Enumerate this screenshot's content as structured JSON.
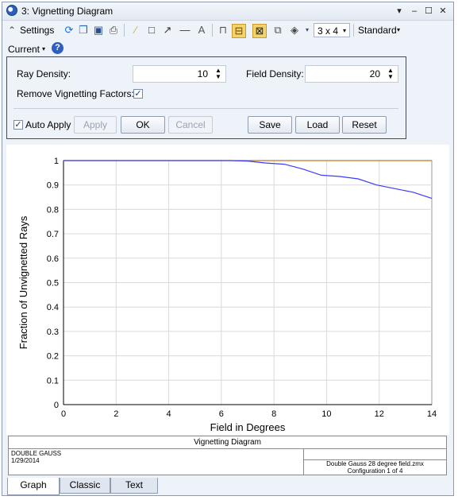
{
  "window": {
    "title": "3: Vignetting Diagram"
  },
  "toolbar": {
    "settings_label": "Settings",
    "grid_layout": "3 x 4",
    "standard_label": "Standard",
    "current_label": "Current",
    "text_tool": "A"
  },
  "settings": {
    "ray_density_label": "Ray Density:",
    "ray_density_value": "10",
    "field_density_label": "Field Density:",
    "field_density_value": "20",
    "remove_vignetting_label": "Remove Vignetting Factors:",
    "remove_vignetting_checked": true,
    "auto_apply_label": "Auto Apply",
    "auto_apply_checked": true,
    "apply_label": "Apply",
    "ok_label": "OK",
    "cancel_label": "Cancel",
    "save_label": "Save",
    "load_label": "Load",
    "reset_label": "Reset"
  },
  "chart_data": {
    "type": "line",
    "xlabel": "Field in Degrees",
    "ylabel": "Fraction of Unvignetted Rays",
    "xlim": [
      0,
      14
    ],
    "ylim": [
      0,
      1
    ],
    "x_ticks": [
      "0",
      "2",
      "4",
      "6",
      "8",
      "10",
      "12",
      "14"
    ],
    "y_ticks": [
      "0",
      "0.1",
      "0.2",
      "0.3",
      "0.4",
      "0.5",
      "0.6",
      "0.7",
      "0.8",
      "0.9",
      "1"
    ],
    "grid": true,
    "series": [
      {
        "color": "#c0782b",
        "x": [
          0,
          14
        ],
        "y": [
          1.0,
          1.0
        ]
      },
      {
        "color": "#3b3bff",
        "x": [
          0,
          0.7,
          1.4,
          2.1,
          2.8,
          3.5,
          4.2,
          4.9,
          5.6,
          6.3,
          7.0,
          7.7,
          8.4,
          9.1,
          9.8,
          10.5,
          11.2,
          11.9,
          12.6,
          13.3,
          14.0
        ],
        "y": [
          1.0,
          1.0,
          1.0,
          1.0,
          1.0,
          1.0,
          1.0,
          1.0,
          1.0,
          1.0,
          0.998,
          0.99,
          0.985,
          0.965,
          0.94,
          0.935,
          0.925,
          0.9,
          0.885,
          0.87,
          0.845
        ]
      }
    ]
  },
  "footer": {
    "title": "Vignetting Diagram",
    "lens_name": "DOUBLE GAUSS",
    "date": "1/29/2014",
    "file_name": "Double Gauss 28 degree field.zmx",
    "configuration": "Configuration 1 of 4"
  },
  "tabs": [
    "Graph",
    "Classic",
    "Text"
  ]
}
